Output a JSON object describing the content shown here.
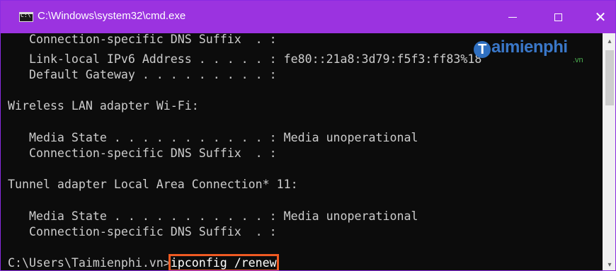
{
  "window": {
    "title": "C:\\Windows\\system32\\cmd.exe",
    "icon": "cmd-icon",
    "title_color": "#9b33e0"
  },
  "controls": {
    "minimize": "minimize-icon",
    "maximize": "maximize-icon",
    "close": "close-icon",
    "close_glyph": "✕"
  },
  "console": {
    "lines": [
      "   Connection-specific DNS Suffix  . :",
      "   Link-local IPv6 Address . . . . . : fe80::21a8:3d79:f5f3:ff83%18",
      "   Default Gateway . . . . . . . . . :",
      "",
      "Wireless LAN adapter Wi-Fi:",
      "",
      "   Media State . . . . . . . . . . . : Media unoperational",
      "   Connection-specific DNS Suffix  . :",
      "",
      "Tunnel adapter Local Area Connection* 11:",
      "",
      "   Media State . . . . . . . . . . . : Media unoperational",
      "   Connection-specific DNS Suffix  . :",
      ""
    ],
    "prompt": "C:\\Users\\Taimienphi.vn>",
    "command": "ipconfig /renew",
    "highlight_color": "#f05a22",
    "text_color": "#cccccc",
    "background": "#0c0c0c"
  },
  "watermark": {
    "letter": "T",
    "text": "aimienphi",
    "suffix": ".vn"
  },
  "scrollbar": {
    "up_glyph": "▴",
    "down_glyph": "▾"
  }
}
